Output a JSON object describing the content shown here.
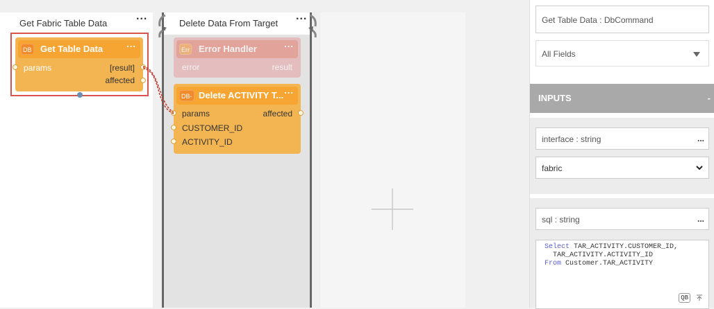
{
  "stages": {
    "stage1": {
      "title": "Get Fabric Table Data",
      "menu": "..."
    },
    "stage2": {
      "title": "Delete Data From Target",
      "menu": "..."
    }
  },
  "actors": {
    "get_table_data": {
      "badge": "DB",
      "title": "Get Table Data",
      "menu": "...",
      "ports": {
        "in_params": "params",
        "out_result": "[result]",
        "out_affected": "affected"
      }
    },
    "error_handler": {
      "badge": "Err",
      "title": "Error Handler",
      "menu": "...",
      "ports": {
        "in_error": "error",
        "out_result": "result"
      }
    },
    "delete_activity": {
      "badge": "DB-",
      "title": "Delete ACTIVITY T...",
      "menu": "...",
      "ports": {
        "in_params": "params",
        "out_affected": "affected",
        "in_customer": "CUSTOMER_ID",
        "in_activity": "ACTIVITY_ID"
      }
    }
  },
  "panel": {
    "actor_name": "Get Table Data : DbCommand",
    "fields_select": "All Fields",
    "inputs_header": "INPUTS",
    "inputs_collapse": "-",
    "interface": {
      "label": "interface : string",
      "menu": "...",
      "value": "fabric"
    },
    "sql": {
      "label": "sql : string",
      "menu": "...",
      "line1_kw": "Select",
      "line1_rest": " TAR_ACTIVITY.CUSTOMER_ID,",
      "line2": "  TAR_ACTIVITY.ACTIVITY_ID",
      "line3_kw": "From",
      "line3_rest": " Customer.TAR_ACTIVITY",
      "qb_button": "QB"
    }
  },
  "colors": {
    "actor": "#f3b552",
    "actor_head": "#f6a532",
    "selection": "#d9534f",
    "link": "#c0392b",
    "panel_header": "#a9a9a9"
  }
}
